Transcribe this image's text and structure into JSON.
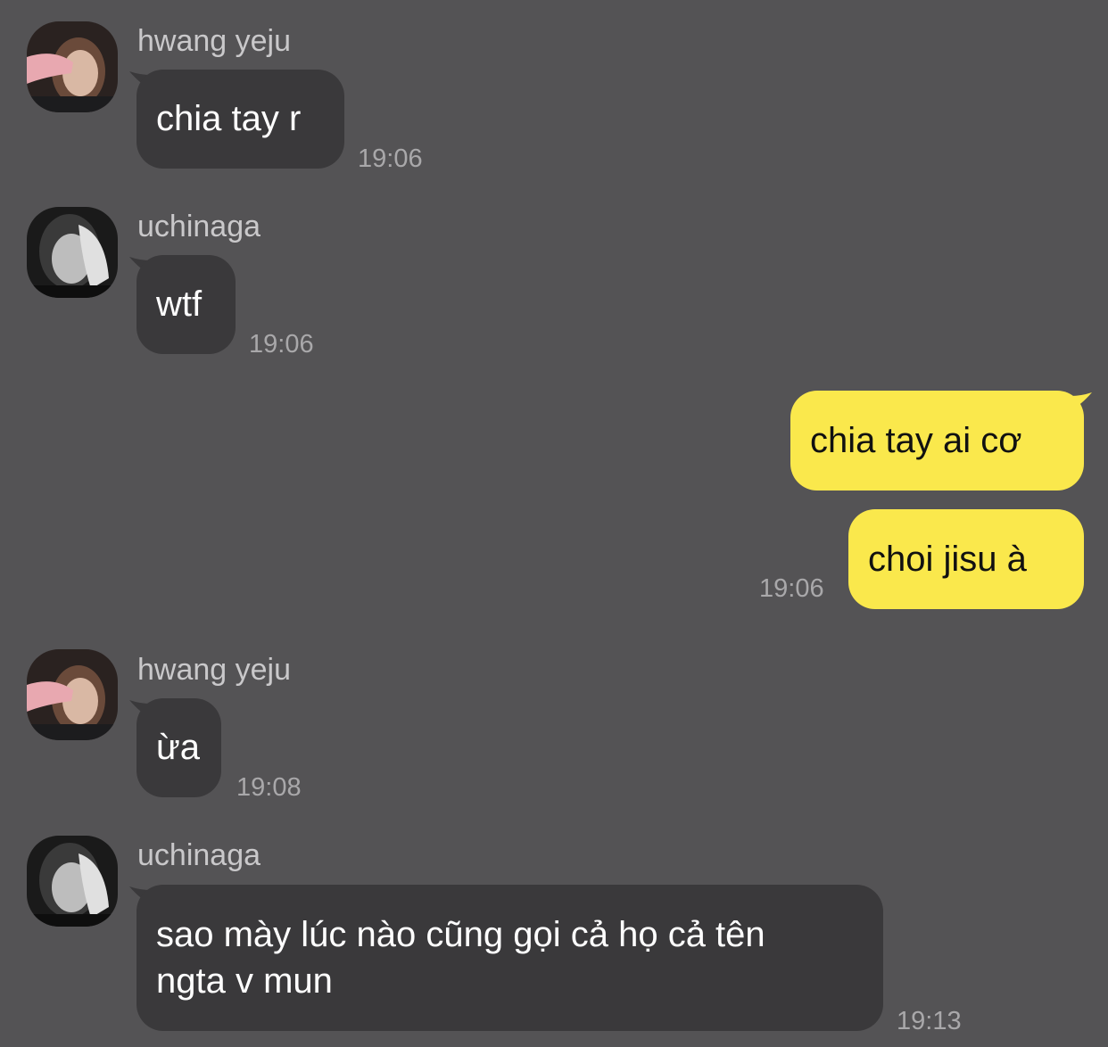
{
  "colors": {
    "background": "#545355",
    "incoming_bubble": "#3a393b",
    "outgoing_bubble": "#fae84c",
    "sender_name": "#c9c8ca",
    "timestamp": "#a9a8aa"
  },
  "messages": [
    {
      "sender": "hwang yeju",
      "avatar_icon": "user-avatar-icon",
      "text": "chia tay r",
      "time": "19:06"
    },
    {
      "sender": "uchinaga",
      "avatar_icon": "user-avatar-icon",
      "text": "wtf",
      "time": "19:06"
    },
    {
      "outgoing": true,
      "text_1": "chia tay ai cơ",
      "text_2": "choi jisu à",
      "time": "19:06"
    },
    {
      "sender": "hwang yeju",
      "avatar_icon": "user-avatar-icon",
      "text": "ừa",
      "time": "19:08"
    },
    {
      "sender": "uchinaga",
      "avatar_icon": "user-avatar-icon",
      "line_1": "sao mày lúc nào cũng gọi cả họ cả tên",
      "line_2": "ngta v mun",
      "time": "19:13"
    }
  ]
}
